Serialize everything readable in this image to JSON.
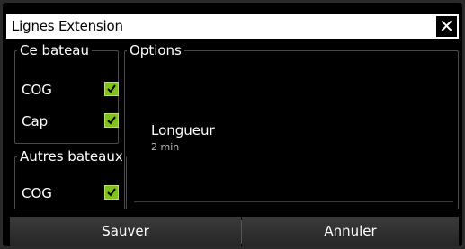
{
  "dialog": {
    "title": "Lignes Extension",
    "close_icon": "close-icon"
  },
  "ce_bateau": {
    "legend": "Ce bateau",
    "items": [
      {
        "label": "COG",
        "checked": true
      },
      {
        "label": "Cap",
        "checked": true
      }
    ]
  },
  "autres_bateaux": {
    "legend": "Autres bateaux",
    "items": [
      {
        "label": "COG",
        "checked": true
      }
    ]
  },
  "options": {
    "legend": "Options",
    "setting_label": "Longueur",
    "setting_value": "2 min"
  },
  "footer": {
    "save_label": "Sauver",
    "cancel_label": "Annuler"
  },
  "colors": {
    "checkbox_green": "#7fc11d",
    "titlebar_bg": "#ffffff",
    "dialog_bg": "#000000"
  }
}
